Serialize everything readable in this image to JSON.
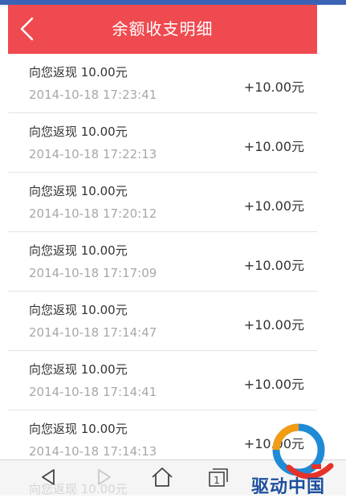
{
  "header": {
    "title": "余额收支明细"
  },
  "transactions": [
    {
      "desc": "向您返现 10.00元",
      "time": "2014-10-18 17:23:41",
      "amount": "+10.00元"
    },
    {
      "desc": "向您返现 10.00元",
      "time": "2014-10-18 17:22:13",
      "amount": "+10.00元"
    },
    {
      "desc": "向您返现 10.00元",
      "time": "2014-10-18 17:20:12",
      "amount": "+10.00元"
    },
    {
      "desc": "向您返现 10.00元",
      "time": "2014-10-18 17:17:09",
      "amount": "+10.00元"
    },
    {
      "desc": "向您返现 10.00元",
      "time": "2014-10-18 17:14:47",
      "amount": "+10.00元"
    },
    {
      "desc": "向您返现 10.00元",
      "time": "2014-10-18 17:14:41",
      "amount": "+10.00元"
    },
    {
      "desc": "向您返现 10.00元",
      "time": "2014-10-18 17:14:13",
      "amount": "+10.00元"
    }
  ],
  "ghost_text": "向您返现 10.00元",
  "watermark": {
    "text": "驱动中国"
  },
  "icons": [
    "back-arrow-icon",
    "nav-back-icon",
    "nav-forward-icon",
    "nav-home-icon",
    "nav-tabs-icon"
  ],
  "tabs_count": "1",
  "colors": {
    "header": "#ef4a4f",
    "topstrip": "#3b63b5",
    "watermark": "#1c4f9d"
  }
}
